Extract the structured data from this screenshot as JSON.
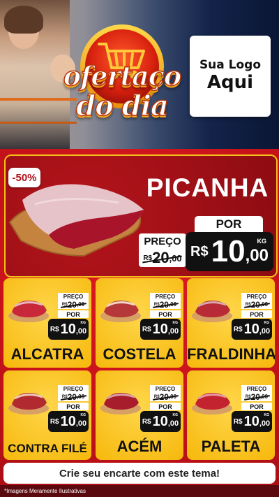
{
  "header": {
    "badge_line1": "ofertaço",
    "badge_line2": "do dia",
    "logo_line1": "Sua Logo",
    "logo_line2": "Aqui"
  },
  "feature": {
    "discount": "-50%",
    "title": "PICANHA",
    "preco_label": "PREÇO",
    "old_currency": "R$",
    "old_price": "20",
    "old_cents": ",00",
    "por_label": "POR",
    "currency": "R$",
    "price": "10",
    "cents": ",00",
    "unit": "KG"
  },
  "products": [
    {
      "name": "ALCATRA",
      "preco_label": "PREÇO",
      "old_currency": "R$",
      "old_price": "20",
      "old_cents": ",00",
      "por_label": "POR",
      "currency": "R$",
      "price": "10",
      "cents": ",00",
      "unit": "KG"
    },
    {
      "name": "COSTELA",
      "preco_label": "PREÇO",
      "old_currency": "R$",
      "old_price": "20",
      "old_cents": ",00",
      "por_label": "POR",
      "currency": "R$",
      "price": "10",
      "cents": ",00",
      "unit": "KG"
    },
    {
      "name": "FRALDINHA",
      "preco_label": "PREÇO",
      "old_currency": "R$",
      "old_price": "20",
      "old_cents": ",00",
      "por_label": "POR",
      "currency": "R$",
      "price": "10",
      "cents": ",00",
      "unit": "KG"
    },
    {
      "name": "CONTRA FILÉ",
      "preco_label": "PREÇO",
      "old_currency": "R$",
      "old_price": "20",
      "old_cents": ",00",
      "por_label": "POR",
      "currency": "R$",
      "price": "10",
      "cents": ",00",
      "unit": "KG"
    },
    {
      "name": "ACÉM",
      "preco_label": "PREÇO",
      "old_currency": "R$",
      "old_price": "20",
      "old_cents": ",00",
      "por_label": "POR",
      "currency": "R$",
      "price": "10",
      "cents": ",00",
      "unit": "KG"
    },
    {
      "name": "PALETA",
      "preco_label": "PREÇO",
      "old_currency": "R$",
      "old_price": "20",
      "old_cents": ",00",
      "por_label": "POR",
      "currency": "R$",
      "price": "10",
      "cents": ",00",
      "unit": "KG"
    }
  ],
  "cta": "Crie seu encarte com este tema!",
  "footer": "*Imagens Meramente Ilustrativas",
  "colors": {
    "red": "#c7121a",
    "yellow": "#f6b80c",
    "gold": "#f3c21a",
    "dark": "#111111"
  }
}
